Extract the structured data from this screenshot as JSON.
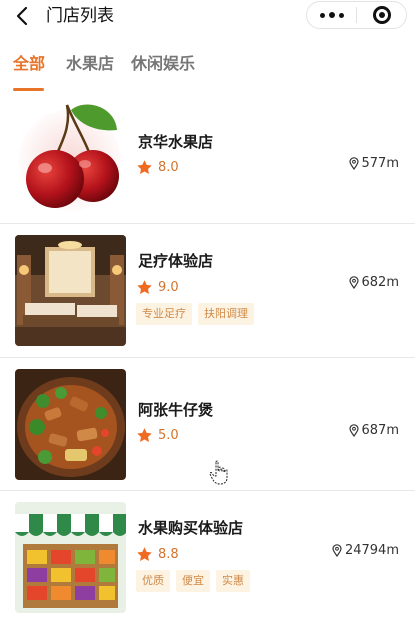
{
  "header": {
    "title": "门店列表"
  },
  "tabs": [
    {
      "label": "全部",
      "active": true
    },
    {
      "label": "水果店",
      "active": false
    },
    {
      "label": "休闲娱乐",
      "active": false
    }
  ],
  "stores": [
    {
      "name": "京华水果店",
      "rating": "8.0",
      "distance": "577m",
      "tags": [],
      "image": "cherry-image"
    },
    {
      "name": "足疗体验店",
      "rating": "9.0",
      "distance": "682m",
      "tags": [
        "专业足疗",
        "扶阳调理"
      ],
      "image": "massage-room-image"
    },
    {
      "name": "阿张牛仔煲",
      "rating": "5.0",
      "distance": "687m",
      "tags": [],
      "image": "beef-pot-image"
    },
    {
      "name": "水果购买体验店",
      "rating": "8.8",
      "distance": "24794m",
      "tags": [
        "优质",
        "便宜",
        "实惠"
      ],
      "image": "fruit-stand-image"
    }
  ],
  "colors": {
    "accent": "#e8742a",
    "tag_bg": "#fdf3e3",
    "tag_text": "#cf8a48",
    "star": "#f06a22"
  }
}
